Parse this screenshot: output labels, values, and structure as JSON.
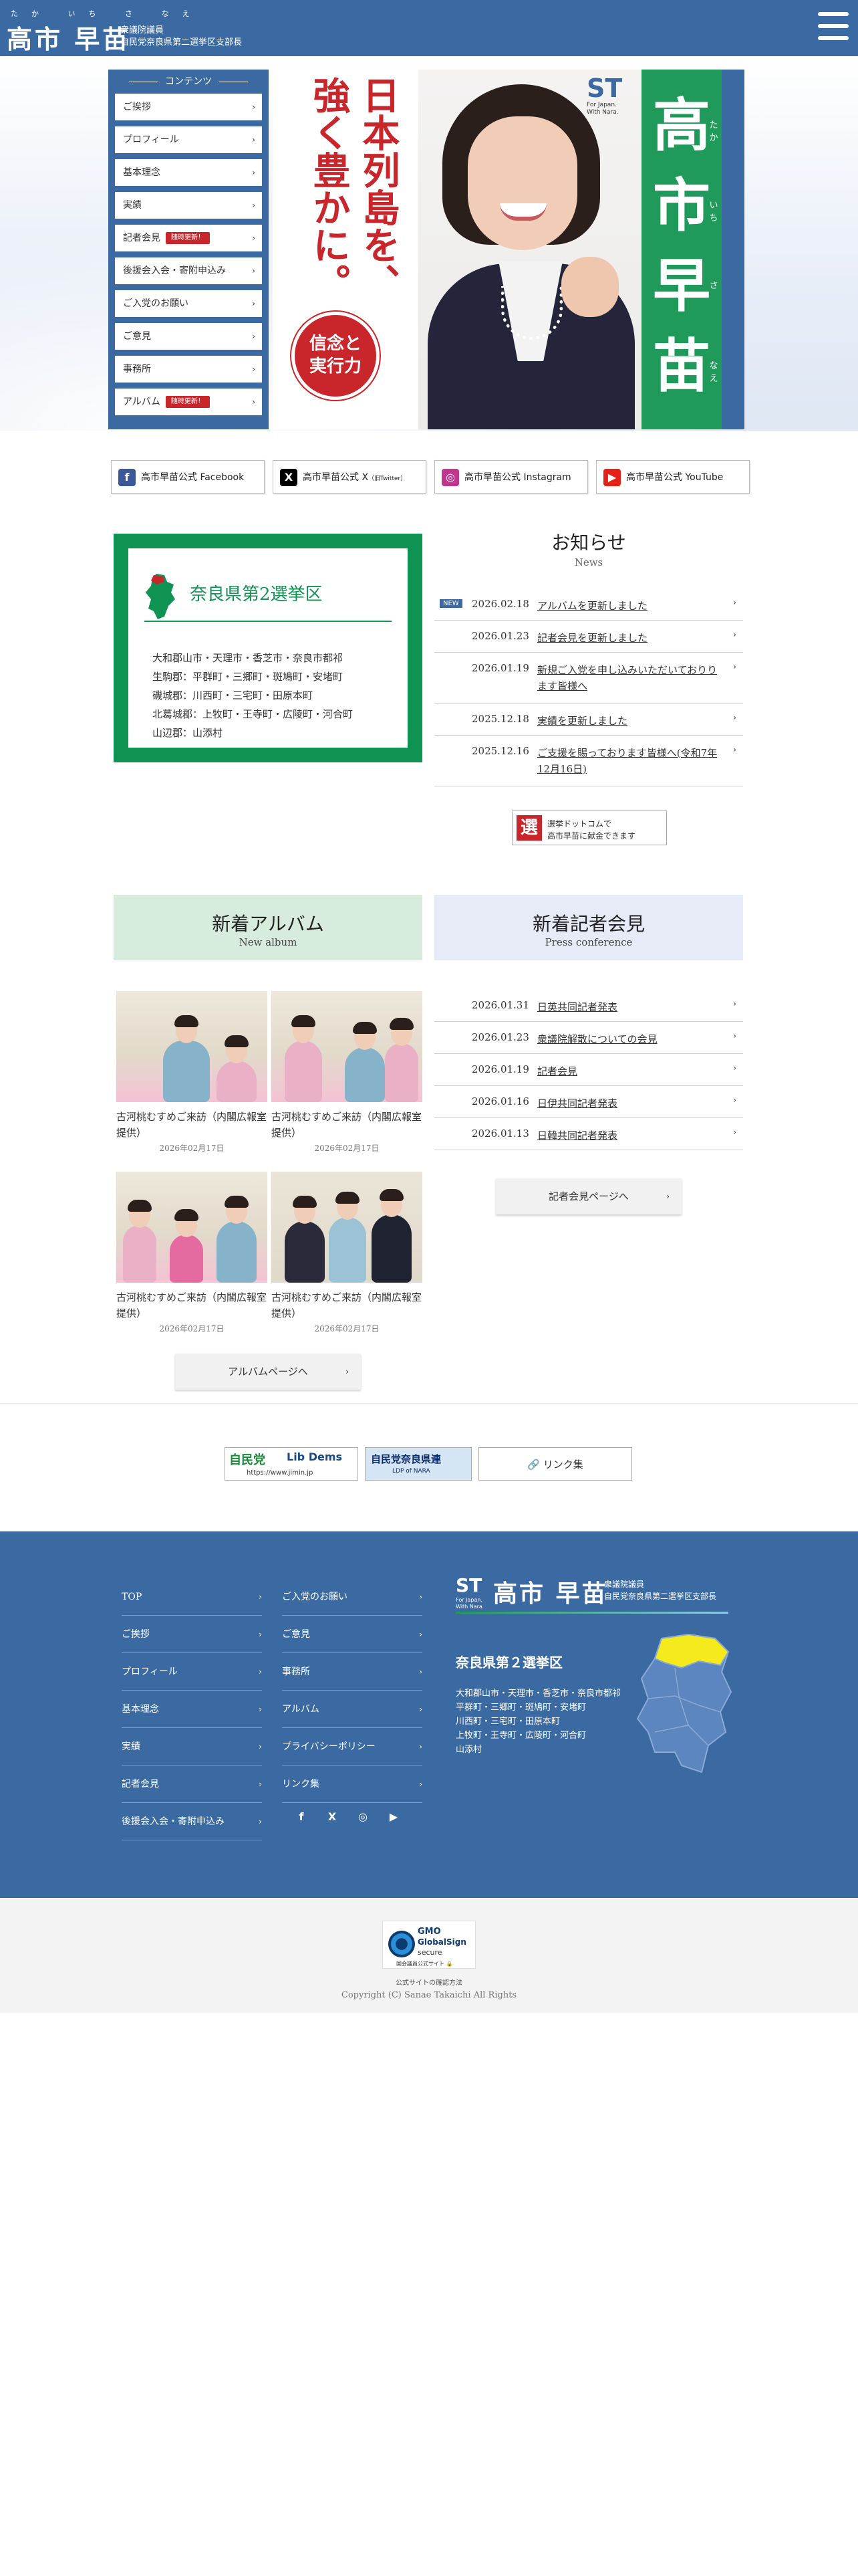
{
  "header": {
    "ruby": "たか いち さ なえ",
    "name": "高市 早苗",
    "sub1": "衆議院議員",
    "sub2": "自民党奈良県第二選挙区支部長"
  },
  "sidenav": {
    "title": "コンテンツ",
    "items": [
      {
        "label": "ご挨拶"
      },
      {
        "label": "プロフィール"
      },
      {
        "label": "基本理念"
      },
      {
        "label": "実績"
      },
      {
        "label": "記者会見",
        "badge": "随時更新！"
      },
      {
        "label": "後援会入会・寄附申込み"
      },
      {
        "label": "ご入党のお願い"
      },
      {
        "label": "ご意見"
      },
      {
        "label": "事務所"
      },
      {
        "label": "アルバム",
        "badge": "随時更新！"
      }
    ]
  },
  "hero": {
    "slogan_col1": "日本列島を、",
    "slogan_col2": "強く豊かに。",
    "pledge_line1": "信念と",
    "pledge_line2": "実行力",
    "st_logo": "ST",
    "st_tag1": "For Japan.",
    "st_tag2": "With Nara.",
    "name_vertical": "高市早苗",
    "kana_vertical": "たかいちさなえ"
  },
  "sns": [
    {
      "label": "高市早苗公式 Facebook",
      "icon": "f",
      "color": "#3b5998"
    },
    {
      "label": "高市早苗公式 X",
      "small": "（旧Twitter）",
      "icon": "X",
      "color": "#000000"
    },
    {
      "label": "高市早苗公式 Instagram",
      "icon": "◎",
      "color": "#c1358f"
    },
    {
      "label": "高市早苗公式 YouTube",
      "icon": "▶",
      "color": "#e62117"
    }
  ],
  "district": {
    "title": "奈良県第2選挙区",
    "areas": [
      "大和郡山市・天理市・香芝市・奈良市都祁",
      "生駒郡：平群町・三郷町・斑鳩町・安堵町",
      "磯城郡：川西町・三宅町・田原本町",
      "北葛城郡：上牧町・王寺町・広陵町・河合町",
      "山辺郡：山添村"
    ]
  },
  "news": {
    "title": "お知らせ",
    "subtitle": "News",
    "new_label": "NEW",
    "items": [
      {
        "date": "2026.02.18",
        "title": "アルバムを更新しました"
      },
      {
        "date": "2026.01.23",
        "title": "記者会見を更新しました"
      },
      {
        "date": "2026.01.19",
        "title": "新規ご入党を申し込みいただいておりります皆様へ"
      },
      {
        "date": "2025.12.18",
        "title": "実績を更新しました"
      },
      {
        "date": "2025.12.16",
        "title": "ご支援を賜っております皆様へ(令和7年12月16日)"
      }
    ],
    "senkyo_mark": "選",
    "senkyo_l1": "選挙ドットコムで",
    "senkyo_l2": "高市早苗に献金できます"
  },
  "album": {
    "title": "新着アルバム",
    "subtitle": "New album",
    "items": [
      {
        "caption": "古河桃むすめご来訪（内閣広報室提供）",
        "date": "2026年02月17日"
      },
      {
        "caption": "古河桃むすめご来訪（内閣広報室提供）",
        "date": "2026年02月17日"
      },
      {
        "caption": "古河桃むすめご来訪（内閣広報室提供）",
        "date": "2026年02月17日"
      },
      {
        "caption": "古河桃むすめご来訪（内閣広報室提供）",
        "date": "2026年02月17日"
      }
    ],
    "button": "アルバムページへ"
  },
  "press": {
    "title": "新着記者会見",
    "subtitle": "Press conference",
    "items": [
      {
        "date": "2026.01.31",
        "title": "日英共同記者発表"
      },
      {
        "date": "2026.01.23",
        "title": "衆議院解散についての会見"
      },
      {
        "date": "2026.01.19",
        "title": "記者会見"
      },
      {
        "date": "2026.01.16",
        "title": "日伊共同記者発表"
      },
      {
        "date": "2026.01.13",
        "title": "日韓共同記者発表"
      }
    ],
    "button": "記者会見ページへ"
  },
  "banners": {
    "jimin_a": "自民党",
    "jimin_b": "Lib Dems",
    "jimin_url": "https://www.jimin.jp",
    "nara": "自民党奈良県連",
    "nara_sub": "LDP of NARA",
    "link": "リンク集"
  },
  "footer": {
    "col1": [
      "TOP",
      "ご挨拶",
      "プロフィール",
      "基本理念",
      "実績",
      "記者会見",
      "後援会入会・寄附申込み"
    ],
    "col2": [
      "ご入党のお願い",
      "ご意見",
      "事務所",
      "アルバム",
      "プライバシーポリシー",
      "リンク集"
    ],
    "brand_st": "ST",
    "brand_tag1": "For Japan.",
    "brand_tag2": "With Nara.",
    "brand_name": "高市 早苗",
    "brand_s1": "衆議院議員",
    "brand_s2": "自民党奈良県第二選挙区支部長",
    "district": "奈良県第２選挙区",
    "areas": [
      "大和郡山市・天理市・香芝市・奈良市都祁",
      "平群町・三郷町・斑鳩町・安堵町",
      "川西町・三宅町・田原本町",
      "上牧町・王寺町・広陵町・河合町",
      "山添村"
    ]
  },
  "bottom": {
    "gmo_l1": "GMO",
    "gmo_l2": "GlobalSign",
    "gmo_l3": "secure",
    "gmo_l4": "国会議員公式サイト 🔒",
    "verify": "公式サイトの確認方法",
    "copyright": "Copyright (C) Sanae Takaichi All Rights"
  }
}
